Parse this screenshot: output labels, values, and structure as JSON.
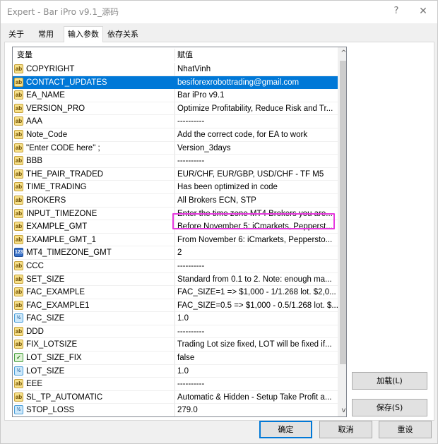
{
  "window": {
    "title": "Expert - Bar iPro v9.1_源码",
    "help_glyph": "?",
    "close_glyph": "✕"
  },
  "tabs": [
    {
      "label": "关于",
      "active": false
    },
    {
      "label": "常用",
      "active": false
    },
    {
      "label": "输入参数",
      "active": true
    },
    {
      "label": "依存关系",
      "active": false
    }
  ],
  "grid": {
    "columns": [
      "变量",
      "赋值"
    ],
    "rows": [
      {
        "type": "string",
        "name": "COPYRIGHT",
        "value": "NhatVinh"
      },
      {
        "type": "string",
        "name": "CONTACT_UPDATES",
        "value": "besiforexrobottrading@gmail.com",
        "selected": true
      },
      {
        "type": "string",
        "name": "EA_NAME",
        "value": "Bar iPro v9.1"
      },
      {
        "type": "string",
        "name": "VERSION_PRO",
        "value": "Optimize Profitability, Reduce Risk and Tr..."
      },
      {
        "type": "string",
        "name": "AAA",
        "value": "----------"
      },
      {
        "type": "string",
        "name": "Note_Code",
        "value": "Add the correct code, for EA to work"
      },
      {
        "type": "string",
        "name": "\"Enter CODE here\" ;",
        "value": "Version_3days"
      },
      {
        "type": "string",
        "name": "BBB",
        "value": "----------"
      },
      {
        "type": "string",
        "name": "THE_PAIR_TRADED",
        "value": "EUR/CHF, EUR/GBP, USD/CHF - TF M5",
        "highlighted": true
      },
      {
        "type": "string",
        "name": "TIME_TRADING",
        "value": "Has been optimized in code"
      },
      {
        "type": "string",
        "name": "BROKERS",
        "value": "All Brokers ECN, STP"
      },
      {
        "type": "string",
        "name": "INPUT_TIMEZONE",
        "value": "Enter the time zone MT4 Brokers you are..."
      },
      {
        "type": "string",
        "name": "EXAMPLE_GMT",
        "value": "Before November 5: iCmarkets, Pepperst..."
      },
      {
        "type": "string",
        "name": "EXAMPLE_GMT_1",
        "value": "From November 6: iCmarkets, Peppersto..."
      },
      {
        "type": "int",
        "name": "MT4_TIMEZONE_GMT",
        "value": "2"
      },
      {
        "type": "string",
        "name": "CCC",
        "value": "----------"
      },
      {
        "type": "string",
        "name": "SET_SIZE",
        "value": "Standard from 0.1 to 2. Note: enough ma..."
      },
      {
        "type": "string",
        "name": "FAC_EXAMPLE",
        "value": "FAC_SIZE=1 => $1,000 - 1/1.268 lot. $2,0..."
      },
      {
        "type": "string",
        "name": "FAC_EXAMPLE1",
        "value": "FAC_SIZE=0.5 => $1,000 - 0.5/1.268 lot. $..."
      },
      {
        "type": "double",
        "name": "FAC_SIZE",
        "value": "1.0"
      },
      {
        "type": "string",
        "name": "DDD",
        "value": "----------"
      },
      {
        "type": "string",
        "name": "FIX_LOTSIZE",
        "value": "Trading Lot size fixed, LOT will be fixed if..."
      },
      {
        "type": "bool",
        "name": "LOT_SIZE_FIX",
        "value": "false"
      },
      {
        "type": "double",
        "name": "LOT_SIZE",
        "value": "1.0"
      },
      {
        "type": "string",
        "name": "EEE",
        "value": "----------"
      },
      {
        "type": "string",
        "name": "SL_TP_AUTOMATIC",
        "value": "Automatic & Hidden - Setup Take Profit a..."
      },
      {
        "type": "double",
        "name": "STOP_LOSS",
        "value": "279.0"
      }
    ]
  },
  "type_badges": {
    "string": "ab",
    "int": "123",
    "double": "½",
    "bool": "✓"
  },
  "scrollbar": {
    "up_glyph": "^",
    "down_glyph": "v"
  },
  "buttons": {
    "load": "加载(L)",
    "save": "保存(S)",
    "ok": "确定",
    "cancel": "取消",
    "reset": "重设"
  },
  "colors": {
    "selection": "#0078d7",
    "highlight_box": "#e63adf"
  }
}
